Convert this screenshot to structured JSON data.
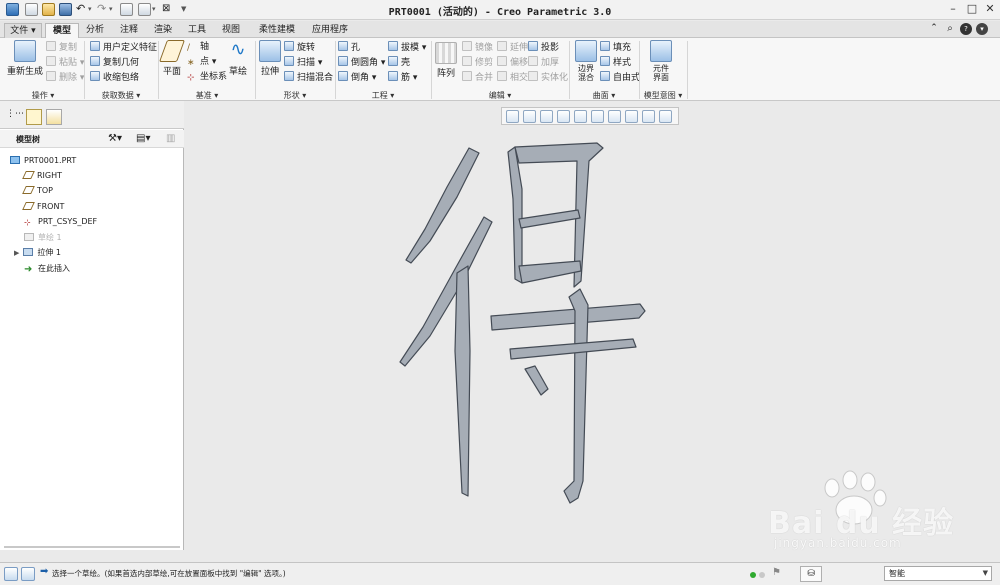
{
  "window": {
    "title": "PRT0001 (活动的) - Creo Parametric 3.0"
  },
  "tabs": [
    {
      "label": "文件"
    },
    {
      "label": "模型"
    },
    {
      "label": "分析"
    },
    {
      "label": "注释"
    },
    {
      "label": "渲染"
    },
    {
      "label": "工具"
    },
    {
      "label": "视图"
    },
    {
      "label": "柔性建模"
    },
    {
      "label": "应用程序"
    }
  ],
  "ribbon": {
    "operations": {
      "regenerate": "重新生成",
      "copy": "复制",
      "paste": "粘贴",
      "delete": "删除",
      "group_label": "操作"
    },
    "get_data": {
      "udf": "用户定义特征",
      "copy_geom": "复制几何",
      "shrinkwrap": "收缩包络",
      "group_label": "获取数据"
    },
    "datum": {
      "plane": "平面",
      "axis": "轴",
      "point": "点",
      "csys": "坐标系",
      "sketch": "草绘",
      "group_label": "基准"
    },
    "shapes": {
      "extrude": "拉伸",
      "revolve": "旋转",
      "sweep": "扫描",
      "swept_blend": "扫描混合",
      "group_label": "形状"
    },
    "engineering": {
      "hole": "孔",
      "round": "倒圆角",
      "chamfer": "倒角",
      "draft": "拔模",
      "shell": "壳",
      "rib": "筋",
      "group_label": "工程"
    },
    "editing": {
      "pattern": "阵列",
      "mirror": "镜像",
      "trim": "修剪",
      "merge": "合并",
      "extend": "延伸",
      "offset": "偏移",
      "intersect": "相交",
      "project": "投影",
      "thicken": "加厚",
      "solidify": "实体化",
      "group_label": "编辑"
    },
    "surfaces": {
      "boundary_blend": "边界混合",
      "fill": "填充",
      "style": "样式",
      "freestyle": "自由式",
      "group_label": "曲面"
    },
    "model_intent": {
      "component_interface": "元件界面",
      "group_label": "模型意图"
    }
  },
  "model_tree": {
    "header": "模型树",
    "items": [
      {
        "label": "PRT0001.PRT",
        "type": "part"
      },
      {
        "label": "RIGHT",
        "type": "plane"
      },
      {
        "label": "TOP",
        "type": "plane"
      },
      {
        "label": "FRONT",
        "type": "plane"
      },
      {
        "label": "PRT_CSYS_DEF",
        "type": "csys"
      },
      {
        "label": "草绘 1",
        "type": "sketch",
        "suppressed": true
      },
      {
        "label": "拉伸 1",
        "type": "extrude",
        "expandable": true
      },
      {
        "label": "在此插入",
        "type": "insert"
      }
    ]
  },
  "graphics": {
    "model_glyph": "得",
    "model_color": "#a6adb6"
  },
  "statusbar": {
    "message": "选择一个草绘。(如果首选内部草绘,可在放置面板中找到 \"编辑\" 选项。)",
    "filter_value": "智能"
  },
  "watermark": {
    "text": "Bai du 经验",
    "url": "jingyan.baidu.com"
  },
  "colors": {
    "accent": "#2e6eb5",
    "model_fill": "#a6adb6",
    "model_edge": "#444b55"
  }
}
